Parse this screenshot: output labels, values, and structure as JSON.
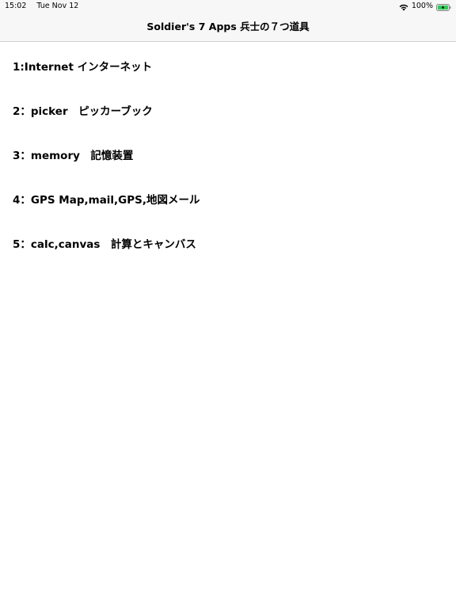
{
  "status_bar": {
    "time": "15:02",
    "date": "Tue Nov 12",
    "battery_percent": "100%",
    "wifi_icon": "wifi-icon",
    "battery_icon": "battery-charging-icon",
    "battery_color": "#34c759"
  },
  "nav": {
    "title": "Soldier's 7 Apps 兵士の７つ道具"
  },
  "items": [
    {
      "label": "1:Internet インターネット"
    },
    {
      "label": "2：picker　ピッカーブック"
    },
    {
      "label": "3：memory　記憶装置"
    },
    {
      "label": "4：GPS Map,mail,GPS,地図メール"
    },
    {
      "label": "5：calc,canvas　計算とキャンバス"
    }
  ]
}
